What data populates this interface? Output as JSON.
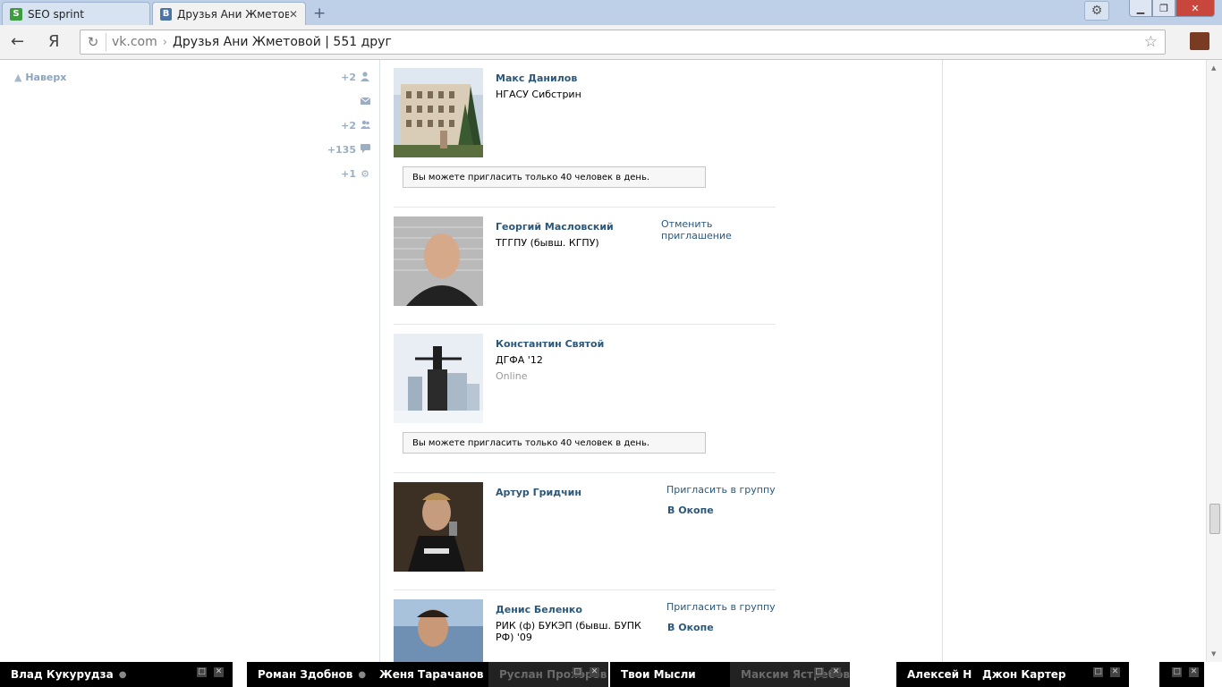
{
  "browser": {
    "tabs": [
      {
        "title": "SEO sprint",
        "favicon": "S",
        "active": false
      },
      {
        "title": "Друзья Ани Жметово",
        "favicon": "B",
        "active": true
      }
    ],
    "url_domain": "vk.com",
    "url_arrow": "›",
    "url_title": "Друзья Ани Жметовой | 551 друг",
    "ya_label": "Я"
  },
  "sidebar": {
    "up_label": "Наверх",
    "stats": [
      {
        "count": "+2",
        "icon": "user-icon"
      },
      {
        "count": "",
        "icon": "mail-icon"
      },
      {
        "count": "+2",
        "icon": "users-icon"
      },
      {
        "count": "+135",
        "icon": "comment-icon"
      },
      {
        "count": "+1",
        "icon": "gear-icon"
      }
    ]
  },
  "friends": [
    {
      "name": "Макс Данилов",
      "subtitle": "НГАСУ Сибстрин",
      "notice": "Вы можете пригласить только 40 человек в день."
    },
    {
      "name": "Георгий Масловский",
      "subtitle": "ТГГПУ (бывш. КГПУ)",
      "action": "Отменить приглашение"
    },
    {
      "name": "Константин Святой",
      "subtitle": "ДГФА '12",
      "status": "Online",
      "notice": "Вы можете пригласить только 40 человек в день."
    },
    {
      "name": "Артур Гридчин",
      "action": "Пригласить в группу",
      "group": "В Окопе"
    },
    {
      "name": "Денис Беленко",
      "subtitle": "РИК (ф) БУКЭП (бывш. БУПК РФ) '09",
      "action": "Пригласить в группу",
      "group": "В Окопе"
    }
  ],
  "chats": [
    {
      "name": "Влад Кукурудза",
      "dot": "●"
    },
    {
      "name": "Роман Здобнов",
      "dot": "●"
    },
    {
      "name": "Женя Тарачанов"
    },
    {
      "name": "Руслан Прохоров"
    },
    {
      "name": "Твои Мысли"
    },
    {
      "name": "Максим Ястребов"
    },
    {
      "name": "Алексей Назаров"
    },
    {
      "name": "Джон Картер"
    }
  ],
  "colors": {
    "link": "#2b587a",
    "muted_link": "#8da4bd",
    "chat_bg": "#000000"
  }
}
